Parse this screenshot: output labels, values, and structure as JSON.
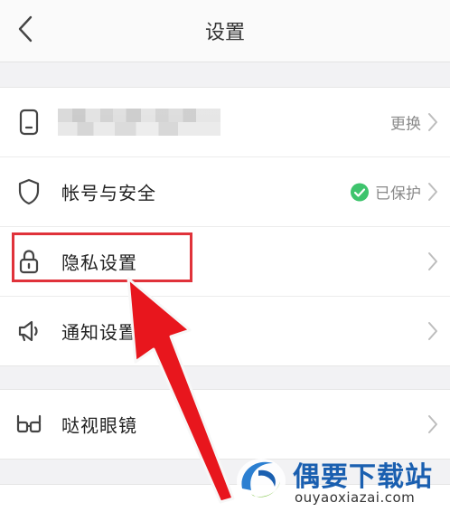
{
  "header": {
    "title": "设置"
  },
  "groups": [
    {
      "rows": [
        {
          "id": "phone",
          "label": "",
          "value": "更换",
          "icon": "phone-icon"
        },
        {
          "id": "account",
          "label": "帐号与安全",
          "value": "已保护",
          "icon": "shield-icon",
          "status_color": "#3ec46d"
        },
        {
          "id": "privacy",
          "label": "隐私设置",
          "value": "",
          "icon": "lock-icon"
        },
        {
          "id": "notify",
          "label": "通知设置",
          "value": "",
          "icon": "speaker-icon"
        }
      ]
    },
    {
      "rows": [
        {
          "id": "glasses",
          "label": "哒视眼镜",
          "value": "",
          "icon": "glasses-icon"
        }
      ]
    }
  ],
  "annotation": {
    "highlight_color": "#e0323a"
  },
  "watermark": {
    "name_cn": "偶要下载站",
    "domain": "ouyaoxiazai.com"
  }
}
